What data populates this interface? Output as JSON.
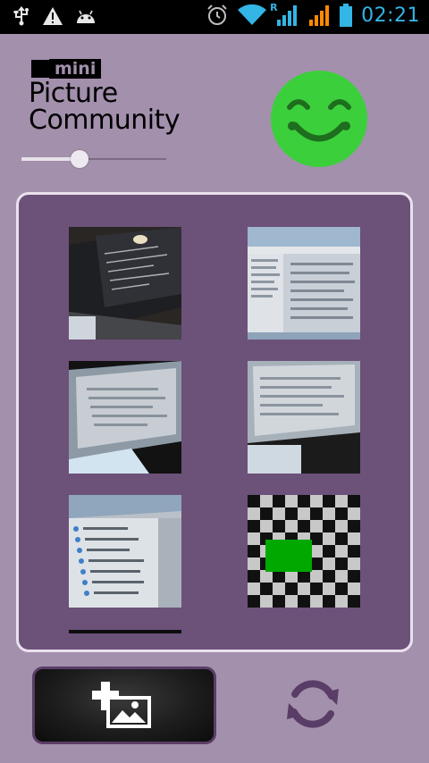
{
  "status_bar": {
    "time": "02:21",
    "roaming_indicator": "R",
    "left_icons": [
      "usb-icon",
      "warning-icon",
      "android-debug-icon"
    ],
    "right_icons": [
      "alarm-icon",
      "wifi-icon",
      "signal-icon",
      "signal-roaming-icon",
      "battery-icon"
    ]
  },
  "header": {
    "logo_mini": "mini",
    "logo_line1": "Picture",
    "logo_line2": "Community",
    "slider_value": 0.4,
    "smiley_color": "#3ccf3c"
  },
  "gallery": {
    "thumbnails": [
      {
        "name": "photo-terminal-screen"
      },
      {
        "name": "photo-file-explorer"
      },
      {
        "name": "photo-monitor-dark"
      },
      {
        "name": "photo-monitor-tilted"
      },
      {
        "name": "photo-project-tree"
      },
      {
        "name": "checkerboard-test-image"
      }
    ]
  },
  "actions": {
    "add_picture_icon": "add-picture-icon",
    "refresh_icon": "refresh-icon",
    "accent_color": "#5a3d66"
  }
}
